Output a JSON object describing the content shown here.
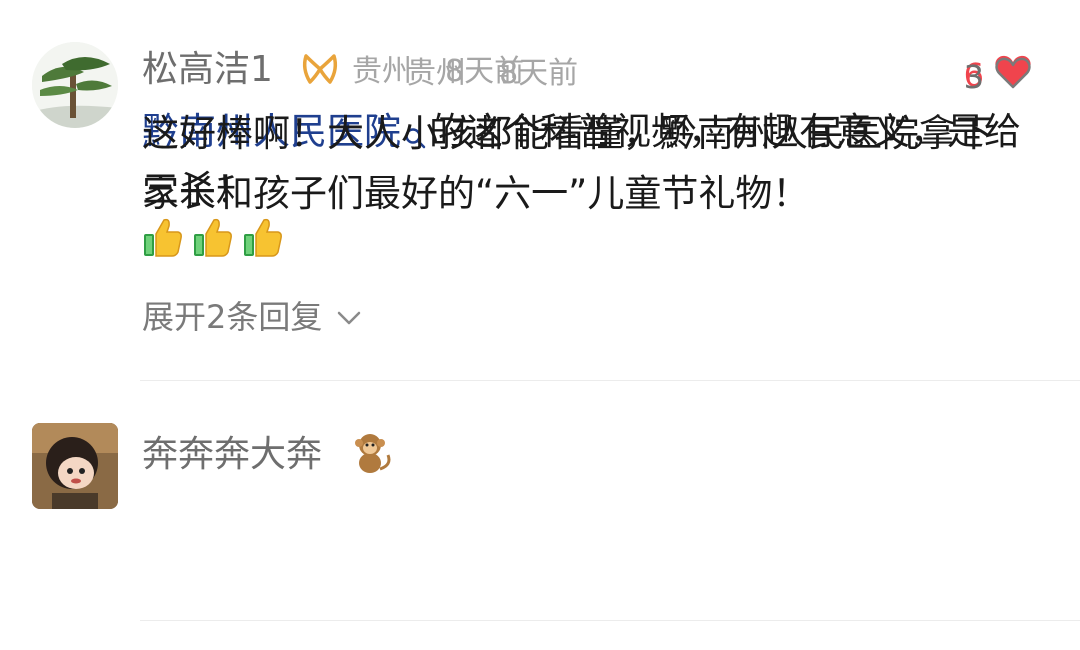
{
  "comments": [
    {
      "username": "松高洁1",
      "badge_icon": "infinity-badge-icon",
      "location": "贵州",
      "time": "8天前",
      "likes": "6",
      "liked": true,
      "text_link": "黔南州人民医院",
      "text_after_link": "的这个科普视频，有趣有意义，是给家长和孩子们最好的“六一”儿童节礼物！",
      "thumbs_count": 3,
      "replies_label": "展开2条回复"
    },
    {
      "username": "奔奔奔大奔",
      "badge_icon": "monkey-badge-icon",
      "location": "贵州",
      "time": "8天前",
      "likes": "3",
      "liked": false,
      "text": "这好棒啊！大人小孩都能看懂，黔南州人民医院拿下三杀！"
    }
  ],
  "colors": {
    "like_active": "#f0444d",
    "like_inactive": "#6e6e6e",
    "link": "#1f3f8f",
    "divider": "#ececec"
  }
}
